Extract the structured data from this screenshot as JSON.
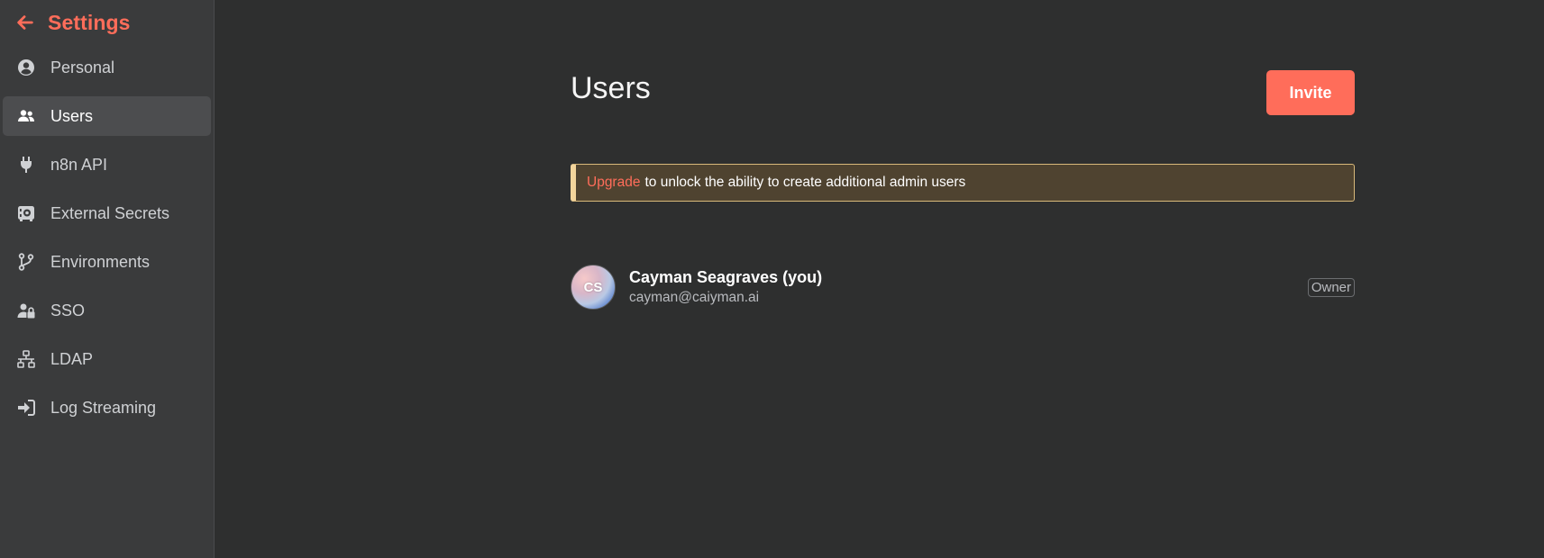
{
  "sidebar": {
    "title": "Settings",
    "back_icon": "arrow-left-icon",
    "items": [
      {
        "label": "Personal",
        "icon": "user-circle-icon",
        "active": false
      },
      {
        "label": "Users",
        "icon": "users-icon",
        "active": true
      },
      {
        "label": "n8n API",
        "icon": "plug-icon",
        "active": false
      },
      {
        "label": "External Secrets",
        "icon": "vault-icon",
        "active": false
      },
      {
        "label": "Environments",
        "icon": "code-branch-icon",
        "active": false
      },
      {
        "label": "SSO",
        "icon": "user-lock-icon",
        "active": false
      },
      {
        "label": "LDAP",
        "icon": "network-wired-icon",
        "active": false
      },
      {
        "label": "Log Streaming",
        "icon": "sign-in-icon",
        "active": false
      }
    ]
  },
  "main": {
    "title": "Users",
    "invite_label": "Invite",
    "banner": {
      "link_text": "Upgrade",
      "text": "to unlock the ability to create additional admin users"
    },
    "users": [
      {
        "initials": "CS",
        "name": "Cayman Seagraves (you)",
        "email": "cayman@caiyman.ai",
        "role": "Owner"
      }
    ]
  },
  "colors": {
    "accent": "#ff6d5a",
    "background": "#2e2f2f",
    "sidebar": "#3a3b3c",
    "banner_bg": "#4f4330",
    "banner_border": "#f3d59c"
  }
}
